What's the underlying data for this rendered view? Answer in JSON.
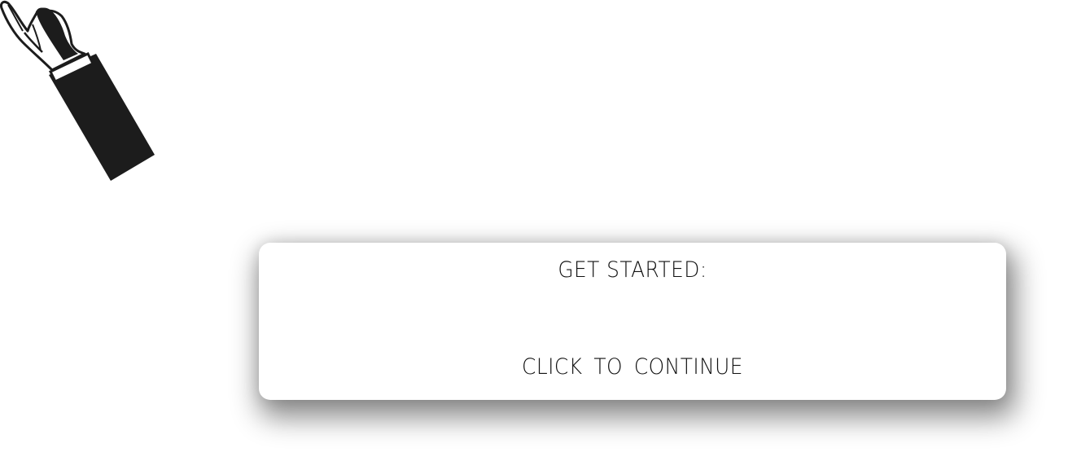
{
  "card": {
    "title": "GET STARTED:",
    "cta": "CLICK TO  CONTINUE"
  },
  "illustration": {
    "icon": "pointing-hand-icon",
    "color": "#1c1c1c"
  },
  "colors": {
    "background": "#ffffff",
    "text": "#111111"
  }
}
